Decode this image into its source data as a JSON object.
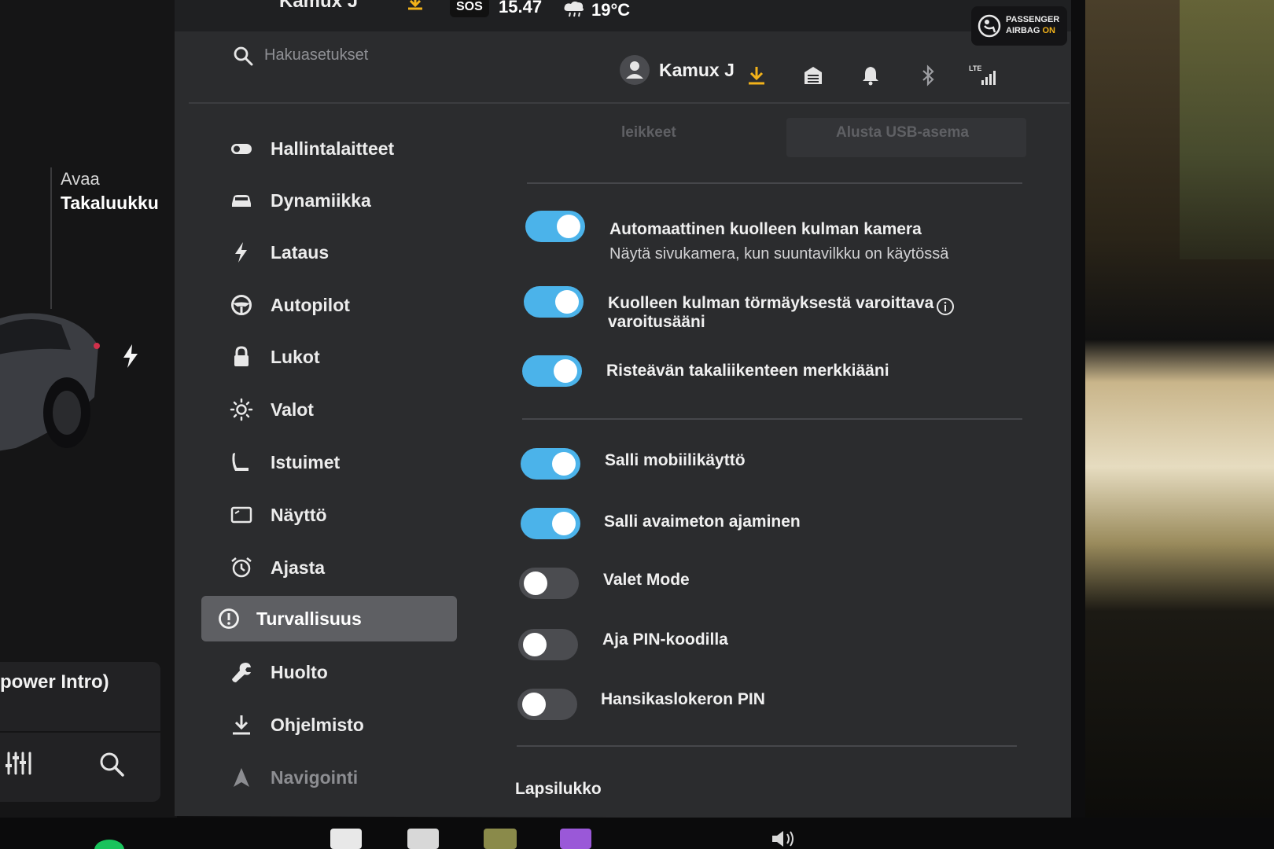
{
  "statusbar": {
    "user_name": "Kamux J",
    "sos": "SOS",
    "time": "15.47",
    "temperature": "19°C",
    "airbag_line1": "PASSENGER",
    "airbag_line2": "AIRBAG",
    "airbag_state": "ON"
  },
  "car_panel": {
    "trunk_line1": "Avaa",
    "trunk_line2": "Takaluukku",
    "media_title": "power Intro)"
  },
  "header": {
    "search_placeholder": "Hakuasetukset",
    "user_name": "Kamux J",
    "icons": [
      "download-icon",
      "garage-icon",
      "bell-icon",
      "bluetooth-icon",
      "lte-signal-icon"
    ],
    "lte_label": "LTE"
  },
  "sidebar": {
    "items": [
      {
        "label": "Hallintalaitteet",
        "icon": "toggle-icon"
      },
      {
        "label": "Dynamiikka",
        "icon": "car-icon"
      },
      {
        "label": "Lataus",
        "icon": "bolt-icon"
      },
      {
        "label": "Autopilot",
        "icon": "steering-wheel-icon"
      },
      {
        "label": "Lukot",
        "icon": "lock-icon"
      },
      {
        "label": "Valot",
        "icon": "sun-icon"
      },
      {
        "label": "Istuimet",
        "icon": "seat-icon"
      },
      {
        "label": "Näyttö",
        "icon": "display-icon"
      },
      {
        "label": "Ajasta",
        "icon": "alarm-clock-icon"
      },
      {
        "label": "Turvallisuus",
        "icon": "alert-circle-icon",
        "active": true
      },
      {
        "label": "Huolto",
        "icon": "wrench-icon"
      },
      {
        "label": "Ohjelmisto",
        "icon": "download-icon"
      },
      {
        "label": "Navigointi",
        "icon": "navigation-icon"
      }
    ]
  },
  "content": {
    "tabs": [
      "leikkeet",
      "Alusta USB-asema"
    ],
    "options": [
      {
        "title": "Automaattinen kuolleen kulman kamera",
        "subtitle": "Näytä sivukamera, kun suuntavilkku on käytössä",
        "on": true
      },
      {
        "title": "Kuolleen kulman törmäyksestä varoittava",
        "title2": "varoitusääni",
        "on": true,
        "info": true
      },
      {
        "title": "Risteävän takaliikenteen merkkiääni",
        "on": true
      },
      {
        "title": "Salli mobiilikäyttö",
        "on": true
      },
      {
        "title": "Salli avaimeton ajaminen",
        "on": true
      },
      {
        "title": "Valet Mode",
        "on": false
      },
      {
        "title": "Aja PIN-koodilla",
        "on": false
      },
      {
        "title": "Hansikaslokeron PIN",
        "on": false
      }
    ],
    "section_title": "Lapsilukko"
  },
  "colors": {
    "toggle_on": "#4bb3ea",
    "toggle_off": "#4b4c50",
    "active_nav": "#5e5f63",
    "airbag_on": "#f2b21a",
    "download_accent": "#f2b21a"
  }
}
